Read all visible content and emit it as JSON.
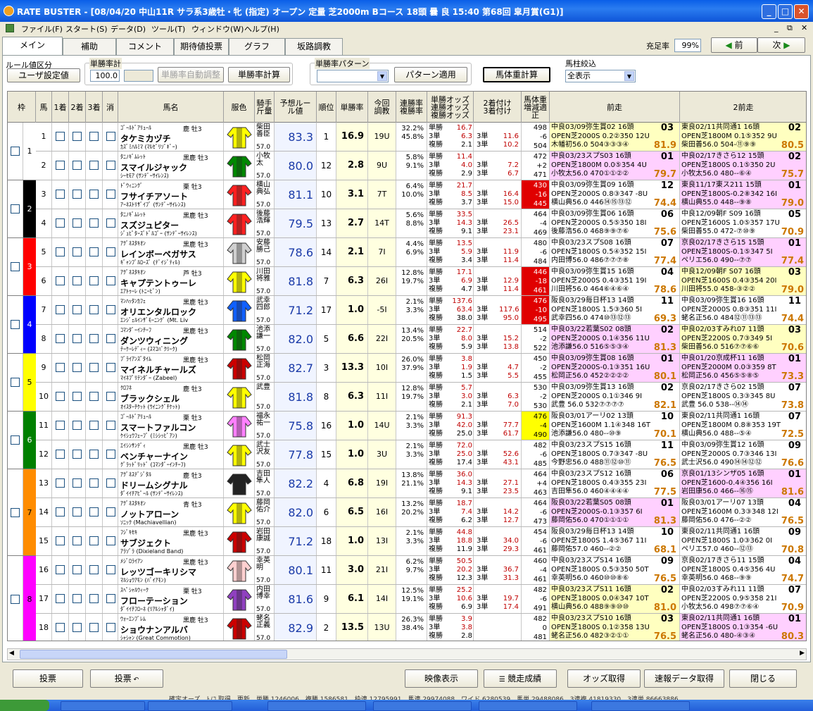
{
  "window": {
    "title": "RATE BUSTER - [08/04/20 中山11R サラ系3歳牡・牝 (指定) オープン 定量 芝2000m Bコース 18頭 曇 良 15:40 第68回 皐月賞(G1)]"
  },
  "menu": [
    "ファイル(F)",
    "スタート(S)",
    "データ(D)",
    "ツール(T)",
    "ウィンドウ(W)",
    "ヘルプ(H)"
  ],
  "tabs": [
    "メイン",
    "補助",
    "コメント",
    "期待値投票",
    "グラフ",
    "坂路調教"
  ],
  "top": {
    "fill_label": "充足率",
    "fill_value": "99%",
    "prev": "前",
    "next": "次"
  },
  "controls": {
    "rule_label": "ルール値区分",
    "rule_value": "ユーザ設定値",
    "winrate_total_label": "単勝率計",
    "winrate_total": "100.0",
    "auto_adjust": "単勝率自動調整",
    "winrate_calc": "単勝率計算",
    "pattern_label": "単勝率パターン",
    "pattern_apply": "パターン適用",
    "weight_calc": "馬体重計算",
    "filter_label": "馬柱絞込",
    "filter_value": "全表示"
  },
  "columns": {
    "waku": "枠",
    "uma": "馬",
    "c1": "1着",
    "c2": "2着",
    "c3": "3着",
    "kesu": "消",
    "name": "馬名",
    "silk": "服色",
    "jockey": "騎手斤量",
    "rate": "予想ルール値",
    "rank": "順位",
    "winrate": "単勝率",
    "chokyo": "今回調教",
    "rentai": "連勝率複勝率",
    "odds": "単勝オッズ連勝オッズ複勝オッズ",
    "tsuke": "2着付け3着付け",
    "bw": "馬体重増減適正",
    "prev1": "前走",
    "prev2": "2前走"
  },
  "waku": [
    {
      "n": "1",
      "color": "#ffffff",
      "rows": 2
    },
    {
      "n": "2",
      "color": "#000000",
      "rows": 2
    },
    {
      "n": "3",
      "color": "#ff0000",
      "rows": 2
    },
    {
      "n": "4",
      "color": "#0000ff",
      "rows": 2
    },
    {
      "n": "5",
      "color": "#ffff00",
      "rows": 2
    },
    {
      "n": "6",
      "color": "#008000",
      "rows": 2
    },
    {
      "n": "7",
      "color": "#ff8c00",
      "rows": 3
    },
    {
      "n": "8",
      "color": "#ff00ff",
      "rows": 3
    }
  ],
  "horses": [
    {
      "uma": "1",
      "sire": "ｺﾞｰﾙﾄﾞｱﾘｭｰﾙ",
      "sexage": "鹿 牡3",
      "name": "タケミカヅチ",
      "dam": "ｶｽﾞﾐﾊﾙﾐﾏ (ﾏﾙｾﾞﾘｿﾞｷﾞｰ)",
      "jockey": "柴田善臣",
      "weight": "57.0",
      "rate": "83.3",
      "rank": "1",
      "win": "16.9",
      "chk": "19U",
      "p1": "32.2%",
      "p2": "45.8%",
      "o1": "16.7",
      "o2": "6.3",
      "o3": "2.1",
      "t1": "11.6",
      "t2": "10.2",
      "b1": "498",
      "b2": "-6",
      "b3": "504",
      "bwbg": "",
      "pv1": [
        "中良03/09弥生賞02 16頭",
        "OPEN芝2000S 0.2②350 12U",
        "木幡初56.0 504③③③④"
      ],
      "pv1sc": "81.9",
      "pv1fin": "03",
      "pv1bg": "#ffffc0",
      "pv2": [
        "東良02/11共同通1 16頭",
        "OPEN芝1800M 0.1⑤352 9U",
        "柴田善56.0 504-⑪⑨⑨"
      ],
      "pv2sc": "80.5",
      "pv2fin": "02",
      "pv2bg": "#ffffc0"
    },
    {
      "uma": "2",
      "sire": "ﾀﾆﾉｷﾞﾑﾚｯﾄ",
      "sexage": "黒鹿 牡3",
      "name": "スマイルジャック",
      "dam": "ｼｰｾﾓｱ (ｻﾝﾃﾞｰｻｲﾚﾝｽ)",
      "jockey": "小牧太",
      "weight": "57.0",
      "rate": "80.0",
      "rank": "12",
      "win": "2.8",
      "chk": "9U",
      "p1": "5.8%",
      "p2": "9.1%",
      "o1": "11.4",
      "o2": "4.0",
      "o3": "2.9",
      "t1": "7.2",
      "t2": "6.7",
      "b1": "472",
      "b2": "+2",
      "b3": "471",
      "bwbg": "",
      "pv1": [
        "中良03/23スプS03 16頭",
        "OPEN芝1800M 0.0⑤354 4U",
        "小牧太56.0 470①①②②"
      ],
      "pv1sc": "79.7",
      "pv1fin": "01",
      "pv1bg": "#ffd0ff",
      "pv2": [
        "中良02/17きさら12 15頭",
        "OPEN芝1800S 0.1⑤350 2U",
        "小牧太56.0 480--⑥④"
      ],
      "pv2sc": "75.7",
      "pv2fin": "02",
      "pv2bg": "#ffd0ff"
    },
    {
      "uma": "3",
      "sire": "ﾄﾞｳｨﾆﾝｸﾞ",
      "sexage": "栗 牡3",
      "name": "フサイチアソート",
      "dam": "ｱｰﾈｽﾄﾘｻﾞｲﾌﾞ (ｻﾝﾃﾞｰｻｲﾚﾝｽ)",
      "jockey": "横山典弘",
      "weight": "57.0",
      "rate": "81.1",
      "rank": "10",
      "win": "3.1",
      "chk": "7T",
      "p1": "6.4%",
      "p2": "10.0%",
      "o1": "21.7",
      "o2": "8.5",
      "o3": "3.7",
      "t1": "16.4",
      "t2": "15.0",
      "b1": "430",
      "b2": "-16",
      "b3": "445",
      "bwbg": "#e00000",
      "pv1": [
        "中良03/09弥生賞09 16頭",
        "OPEN芝2000S 0.8③347 -8U",
        "横山典56.0 446⑭⑮⑬⑫"
      ],
      "pv1sc": "74.4",
      "pv1fin": "12",
      "pv1bg": "#ffffff",
      "pv2": [
        "東良11/17東ス211 15頭",
        "OPEN芝1800S-0.2⑧342 16I",
        "横山典55.0 448--⑨⑧"
      ],
      "pv2sc": "79.0",
      "pv2fin": "01",
      "pv2bg": "#ffd0ff"
    },
    {
      "uma": "4",
      "sire": "ﾀﾆﾉｷﾞﾑﾚｯﾄ",
      "sexage": "黒鹿 牡3",
      "name": "スズジュピター",
      "dam": "ｼﾞｭﾋﾟﾀｰｽﾞﾄﾞﾙｺﾞｰ (ｻﾝﾃﾞｰｻｲﾚﾝｽ)",
      "jockey": "後藤浩輝",
      "weight": "57.0",
      "rate": "79.5",
      "rank": "13",
      "win": "2.7",
      "chk": "14T",
      "p1": "5.6%",
      "p2": "8.8%",
      "o1": "33.5",
      "o2": "14.3",
      "o3": "9.1",
      "t1": "26.5",
      "t2": "23.1",
      "b1": "464",
      "b2": "-4",
      "b3": "469",
      "bwbg": "",
      "pv1": [
        "中良03/09弥生賞06 16頭",
        "OPEN芝2000S 0.5⑤350 18I",
        "後藤浩56.0 468⑨⑨⑦⑥"
      ],
      "pv1sc": "75.6",
      "pv1fin": "06",
      "pv1bg": "#ffffff",
      "pv2": [
        "中良12/09朝F S09 16頭",
        "OPEN芝1600S 1.0⑤357 17U",
        "柴田善55.0 472-⑦⑩⑨"
      ],
      "pv2sc": "70.9",
      "pv2fin": "05",
      "pv2bg": "#ffffff"
    },
    {
      "uma": "5",
      "sire": "ｱｸﾞﾈｽﾀｷｵﾝ",
      "sexage": "黒鹿 牡3",
      "name": "レインボーペガサス",
      "dam": "ｷﾞｬﾝﾌﾞﾙﾛｰｽﾞ (ﾃﾞｲｼﾞﾃｨﾙ)",
      "jockey": "安藤勝己",
      "weight": "57.0",
      "rate": "78.6",
      "rank": "14",
      "win": "2.1",
      "chk": "7I",
      "p1": "4.4%",
      "p2": "6.9%",
      "o1": "13.5",
      "o2": "5.9",
      "o3": "3.4",
      "t1": "11.9",
      "t2": "11.4",
      "b1": "480",
      "b2": "-6",
      "b3": "484",
      "bwbg": "",
      "pv1": [
        "中良03/23スプS08 16頭",
        "OPEN芝1800S 0.5④352 15I",
        "内田博56.0 486⑦⑦⑦⑧"
      ],
      "pv1sc": "77.4",
      "pv1fin": "07",
      "pv1bg": "#ffffff",
      "pv2": [
        "京良02/17きさら15 15頭",
        "OPEN芝1800S-0.1⑤347 5I",
        "ペリエ56.0 490--⑦⑦"
      ],
      "pv2sc": "77.4",
      "pv2fin": "01",
      "pv2bg": "#ffd0ff"
    },
    {
      "uma": "6",
      "sire": "ｱｸﾞﾈｽﾀｷｵﾝ",
      "sexage": "芦 牡3",
      "name": "キャプテントゥーレ",
      "dam": "ｴｱﾄｩｰﾚ (ﾄﾆｰﾋﾞﾝ)",
      "jockey": "川田将雅",
      "weight": "57.0",
      "rate": "81.8",
      "rank": "7",
      "win": "6.3",
      "chk": "26I",
      "p1": "12.8%",
      "p2": "19.7%",
      "o1": "17.1",
      "o2": "6.9",
      "o3": "4.7",
      "t1": "12.9",
      "t2": "11.4",
      "b1": "446",
      "b2": "-18",
      "b3": "461",
      "bwbg": "#e00000",
      "pv1": [
        "中良03/09弥生賞15 16頭",
        "OPEN芝2000S 0.4③351 19I",
        "川田将56.0 464⑥④⑥④"
      ],
      "pv1sc": "78.6",
      "pv1fin": "04",
      "pv1bg": "#ffffff",
      "pv2": [
        "中良12/09朝F S07 16頭",
        "OPEN芝1600S 0.4③354 20I",
        "川田将55.0 458-③②②"
      ],
      "pv2sc": "79.0",
      "pv2fin": "03",
      "pv2bg": "#ffffc0"
    },
    {
      "uma": "7",
      "sire": "ﾏﾝﾊｯﾀﾝｶﾌｪ",
      "sexage": "黒鹿 牡3",
      "name": "オリエンタルロック",
      "dam": "ｴﾝｼﾞｪﾙｲﾝｻﾞﾓｰﾆﾝｸﾞ (Mt. Liv",
      "jockey": "武幸四郎",
      "weight": "57.0",
      "rate": "71.2",
      "rank": "17",
      "win": "1.0",
      "chk": "-5I",
      "p1": "2.1%",
      "p2": "3.3%",
      "o1": "137.6",
      "o2": "63.4",
      "o3": "38.0",
      "t1": "117.6",
      "t2": "95.0",
      "b1": "476",
      "b2": "-10",
      "b3": "495",
      "bwbg": "#e00000",
      "pv1": [
        "阪良03/29毎日杯13 14頭",
        "OPEN芝1800S 1.5③360 5I",
        "武幸四56.0 474⑩⑬⑫⑬"
      ],
      "pv1sc": "69.3",
      "pv1fin": "11",
      "pv1bg": "#ffffff",
      "pv2": [
        "中良03/09弥生賞16 16頭",
        "OPEN芝2000S 0.8③351 11I",
        "蛯名正56.0 484⑫⑪⑬⑬"
      ],
      "pv2sc": "74.4",
      "pv2fin": "11",
      "pv2bg": "#ffffff"
    },
    {
      "uma": "8",
      "sire": "ｺﾏﾝﾀﾞｰｲﾝﾁｰﾌ",
      "sexage": "黒鹿 牡3",
      "name": "ダンツウィニング",
      "dam": "ﾃｰｹｰﾚﾃﾞｨｰ (ｽﾏｺﾊﾞｸﾘｰｸ)",
      "jockey": "池添謙一",
      "weight": "57.0",
      "rate": "82.0",
      "rank": "5",
      "win": "6.6",
      "chk": "22I",
      "p1": "13.4%",
      "p2": "20.5%",
      "o1": "22.7",
      "o2": "8.0",
      "o3": "5.9",
      "t1": "15.2",
      "t2": "13.8",
      "b1": "514",
      "b2": "-2",
      "b3": "522",
      "bwbg": "",
      "pv1": [
        "中良03/22若葉S02 08頭",
        "OPEN芝2000S 0.1④356 11U",
        "池添謙56.0 516⑤⑤③④"
      ],
      "pv1sc": "81.3",
      "pv1fin": "02",
      "pv1bg": "#ffd0ff",
      "pv2": [
        "中良02/03すみれ07 11頭",
        "OPEN芝2200S 0.7③349 5I",
        "柴田善56.0 516⑦⑦⑥⑥"
      ],
      "pv2sc": "70.6",
      "pv2fin": "03",
      "pv2bg": "#ffffc0"
    },
    {
      "uma": "9",
      "sire": "ﾌﾞﾗｲｱﾝｽﾞﾀｲﾑ",
      "sexage": "黒鹿 牡3",
      "name": "マイネルチャールズ",
      "dam": "ﾏｲﾈﾌﾟﾘﾃﾝﾀﾞｰ (Zabeel)",
      "jockey": "松岡正海",
      "weight": "57.0",
      "rate": "82.7",
      "rank": "3",
      "win": "13.3",
      "chk": "10I",
      "p1": "26.0%",
      "p2": "37.9%",
      "o1": "3.8",
      "o2": "1.9",
      "o3": "1.5",
      "t1": "4.7",
      "t2": "5.5",
      "b1": "450",
      "b2": "-2",
      "b3": "455",
      "bwbg": "",
      "pv1": [
        "中良03/09弥生賞08 16頭",
        "OPEN芝2000S-0.1③351 16U",
        "松岡正56.0 452②②②②"
      ],
      "pv1sc": "80.1",
      "pv1fin": "01",
      "pv1bg": "#ffd0ff",
      "pv2": [
        "中良01/20京成杯11 16頭",
        "OPEN芝2000M 0.0③359 8T",
        "松岡正56.0 456⑤⑤⑧⑤"
      ],
      "pv2sc": "73.3",
      "pv2fin": "01",
      "pv2bg": "#ffd0ff"
    },
    {
      "uma": "10",
      "sire": "ｸﾛﾌﾈ",
      "sexage": "鹿 牡3",
      "name": "ブラックシェル",
      "dam": "ｵｲｽﾀｰﾁｹｯﾄ (ｳｲﾆﾝｸﾞﾁｹｯﾄ)",
      "jockey": "武豊",
      "weight": "57.0",
      "rate": "81.8",
      "rank": "8",
      "win": "6.3",
      "chk": "11I",
      "p1": "12.8%",
      "p2": "19.7%",
      "o1": "5.7",
      "o2": "3.0",
      "o3": "2.1",
      "t1": "6.3",
      "t2": "7.0",
      "b1": "530",
      "b2": "-2",
      "b3": "530",
      "bwbg": "",
      "pv1": [
        "中良03/09弥生賞13 16頭",
        "OPEN芝2000S 0.1①346 9I",
        "武豊  56.0 532⑦⑦⑦⑦"
      ],
      "pv1sc": "82.1",
      "pv1fin": "02",
      "pv1bg": "#ffffff",
      "pv2": [
        "京良02/17きさら02 15頭",
        "OPEN芝1800S 0.3③345 8U",
        "武豊  56.0 538--⑭⑭"
      ],
      "pv2sc": "73.8",
      "pv2fin": "07",
      "pv2bg": "#ffffff"
    },
    {
      "uma": "11",
      "sire": "ｺﾞｰﾙﾄﾞｱﾘｭｰﾙ",
      "sexage": "栗 牡3",
      "name": "スマートファルコン",
      "dam": "ｹｲｼｭｳﾌｪｰﾌﾞ (ﾐｼｼｯﾋﾟｱﾝ)",
      "jockey": "福永祐一",
      "weight": "57.0",
      "rate": "75.8",
      "rank": "16",
      "win": "1.0",
      "chk": "14U",
      "p1": "2.1%",
      "p2": "3.3%",
      "o1": "91.3",
      "o2": "42.0",
      "o3": "25.0",
      "t1": "77.7",
      "t2": "61.7",
      "b1": "476",
      "b2": "-4",
      "b3": "490",
      "bwbg": "#ffff00",
      "pv1": [
        "阪良03/01アーリ02 13頭",
        "OPEN芝1600M 1.1④348 16T",
        "池添謙56.0 480--⑩⑨"
      ],
      "pv1sc": "70.1",
      "pv1fin": "10",
      "pv1bg": "#ffffff",
      "pv2": [
        "東良02/11共同通1 16頭",
        "OPEN芝1800M 0.8⑧353 19T",
        "横山典56.0 488--⑤④"
      ],
      "pv2sc": "72.5",
      "pv2fin": "07",
      "pv2bg": "#ffffff"
    },
    {
      "uma": "12",
      "sire": "ｴｲｼﾝｻﾝﾃﾞｨ",
      "sexage": "黒鹿 牡3",
      "name": "ベンチャーナイン",
      "dam": "ｸﾞﾗｯﾄﾞﾘｯﾄﾞ (ｺﾏﾝﾀﾞｰｲﾝﾁｰﾌ)",
      "jockey": "武士沢友",
      "weight": "57.0",
      "rate": "77.8",
      "rank": "15",
      "win": "1.0",
      "chk": "3U",
      "p1": "2.1%",
      "p2": "3.3%",
      "o1": "72.0",
      "o2": "25.0",
      "o3": "17.4",
      "t1": "52.6",
      "t2": "43.1",
      "b1": "482",
      "b2": "-6",
      "b3": "485",
      "bwbg": "",
      "pv1": [
        "中良03/23スプS15 16頭",
        "OPEN芝1800S 0.7③347 -8U",
        "今野忠56.0 488⑪⑫⑩⑪"
      ],
      "pv1sc": "76.5",
      "pv1fin": "11",
      "pv1bg": "#ffffff",
      "pv2": [
        "中良03/09弥生賞12 16頭",
        "OPEN芝2000S 0.7③346 13I",
        "武士沢56.0 490⑭⑭⑫⑫"
      ],
      "pv2sc": "76.6",
      "pv2fin": "09",
      "pv2bg": "#ffffff"
    },
    {
      "uma": "13",
      "sire": "ｱｸﾞﾈｽﾃﾞｼﾞﾀﾙ",
      "sexage": "鹿 牡3",
      "name": "ドリームシグナル",
      "dam": "ﾀﾞｲｲﾁｱﾋﾟｰﾙ (ｻﾝﾃﾞｰｻｲﾚﾝｽ)",
      "jockey": "吉田隼人",
      "weight": "57.0",
      "rate": "82.2",
      "rank": "4",
      "win": "6.8",
      "chk": "19I",
      "p1": "13.8%",
      "p2": "21.1%",
      "o1": "36.0",
      "o2": "14.3",
      "o3": "9.1",
      "t1": "27.1",
      "t2": "23.5",
      "b1": "464",
      "b2": "+4",
      "b3": "463",
      "bwbg": "",
      "pv1": [
        "中良03/23スプS12 16頭",
        "OPEN芝1800S 0.4③355 23I",
        "吉田隼56.0 460④④④④"
      ],
      "pv1sc": "77.5",
      "pv1fin": "06",
      "pv1bg": "#ffffff",
      "pv2": [
        "京良01/13シンザ05 16頭",
        "OPEN芝1600-0.4④356 16I",
        "岩田康56.0 466--⑯⑮"
      ],
      "pv2sc": "81.6",
      "pv2fin": "01",
      "pv2bg": "#ffd0ff"
    },
    {
      "uma": "14",
      "sire": "ｱｸﾞﾈｽﾀｷｵﾝ",
      "sexage": "青 牡3",
      "name": "ノットアローン",
      "dam": "ｿﾆｯｸ (Machiavellian)",
      "jockey": "藤岡佑介",
      "weight": "57.0",
      "rate": "82.0",
      "rank": "6",
      "win": "6.5",
      "chk": "16I",
      "p1": "13.2%",
      "p2": "20.2%",
      "o1": "18.7",
      "o2": "7.4",
      "o3": "6.2",
      "t1": "14.2",
      "t2": "12.7",
      "b1": "464",
      "b2": "-6",
      "b3": "473",
      "bwbg": "",
      "pv1": [
        "阪良03/22若葉S05 08頭",
        "OPEN芝2000S-0.1③357 6I",
        "藤岡佑56.0 470①①①①"
      ],
      "pv1sc": "81.3",
      "pv1fin": "01",
      "pv1bg": "#ffd0ff",
      "pv2": [
        "阪良03/01アーリ07 13頭",
        "OPEN芝1600M 0.3③348 12I",
        "藤岡佑56.0 476--②②"
      ],
      "pv2sc": "76.5",
      "pv2fin": "04",
      "pv2bg": "#ffffff"
    },
    {
      "uma": "15",
      "sire": "ﾌｼﾞｷｾｷ",
      "sexage": "黒鹿 牡3",
      "name": "サブジェクト",
      "dam": "ｱﾗｿﾞﾗ (Dixieland Band)",
      "jockey": "岩田康誠",
      "weight": "57.0",
      "rate": "71.2",
      "rank": "18",
      "win": "1.0",
      "chk": "13I",
      "p1": "2.1%",
      "p2": "3.3%",
      "o1": "44.8",
      "o2": "18.8",
      "o3": "11.9",
      "t1": "34.0",
      "t2": "29.3",
      "b1": "454",
      "b2": "-6",
      "b3": "461",
      "bwbg": "",
      "pv1": [
        "阪良03/29毎日杯13 14頭",
        "OPEN芝1800S 1.4⑤367 11I",
        "藤岡佑57.0 460--②②"
      ],
      "pv1sc": "68.1",
      "pv1fin": "10",
      "pv1bg": "#ffffff",
      "pv2": [
        "東良02/11共同通1 16頭",
        "OPEN芝1800S 1.0③362 0I",
        "ペリエ57.0 460--⑫⑬"
      ],
      "pv2sc": "70.8",
      "pv2fin": "09",
      "pv2bg": "#ffffff"
    },
    {
      "uma": "16",
      "sire": "ﾒｼﾞﾛﾗｲｱﾝ",
      "sexage": "黒鹿 牡3",
      "name": "レッツゴーキリシマ",
      "dam": "ﾏﾙｼｮｳｱﾓﾝ (ﾊﾞｲｱﾓﾝ)",
      "jockey": "幸英明",
      "weight": "57.0",
      "rate": "80.1",
      "rank": "11",
      "win": "3.0",
      "chk": "21I",
      "p1": "6.2%",
      "p2": "9.7%",
      "o1": "50.5",
      "o2": "20.2",
      "o3": "12.3",
      "t1": "36.7",
      "t2": "31.3",
      "b1": "460",
      "b2": "-4",
      "b3": "461",
      "bwbg": "",
      "pv1": [
        "中良03/23スプS14 16頭",
        "OPEN芝1800S 0.5③350 50T",
        "幸英明56.0 460⑩⑩⑧⑥"
      ],
      "pv1sc": "76.5",
      "pv1fin": "09",
      "pv1bg": "#ffffff",
      "pv2": [
        "京良02/17きさら11 15頭",
        "OPEN芝1800S 0.4⑤356 4U",
        "幸英明56.0 468--⑨⑨"
      ],
      "pv2sc": "74.7",
      "pv2fin": "04",
      "pv2bg": "#ffffff"
    },
    {
      "uma": "17",
      "sire": "ｽﾍﾟｼｬﾙｳｨｰｸ",
      "sexage": "栗 牡3",
      "name": "フローテーション",
      "dam": "ﾀﾞｲｲﾁﾌﾛｰﾈ (ﾘｱﾙｼｬﾀﾞｲ)",
      "jockey": "内田博幸",
      "weight": "57.0",
      "rate": "81.6",
      "rank": "9",
      "win": "6.1",
      "chk": "14I",
      "p1": "12.5%",
      "p2": "19.1%",
      "o1": "25.2",
      "o2": "10.6",
      "o3": "6.9",
      "t1": "19.7",
      "t2": "17.4",
      "b1": "482",
      "b2": "-6",
      "b3": "491",
      "bwbg": "",
      "pv1": [
        "中良03/23スプS11 16頭",
        "OPEN芝1800S 0.0④347 10T",
        "横山典56.0 488⑨⑨⑩⑩"
      ],
      "pv1sc": "81.0",
      "pv1fin": "02",
      "pv1bg": "#ffffc0",
      "pv2": [
        "中良02/03すみれ11 11頭",
        "OPEN芝2200S 0.9⑤358 21I",
        "小牧太56.0 498⑦⑦⑥④"
      ],
      "pv2sc": "70.9",
      "pv2fin": "07",
      "pv2bg": "#ffffff"
    },
    {
      "uma": "18",
      "sire": "ｳｫｰｴﾝﾌﾞﾚﾑ",
      "sexage": "黒鹿 牡3",
      "name": "ショウナンアルバ",
      "dam": "ｼｬｼｬﾝ (Great Commotion)",
      "jockey": "蛯名正義",
      "weight": "57.0",
      "rate": "82.9",
      "rank": "2",
      "win": "13.5",
      "chk": "13U",
      "p1": "26.3%",
      "p2": "38.4%",
      "o1": "3.9",
      "o2": "3.8",
      "o3": "2.8",
      "t1": "",
      "t2": "",
      "b1": "482",
      "b2": "0",
      "b3": "481",
      "bwbg": "",
      "pv1": [
        "中良03/23スプS10 16頭",
        "OPEN芝1800S 0.1②358 13U",
        "蛯名正56.0 482③②①①"
      ],
      "pv1sc": "76.5",
      "pv1fin": "03",
      "pv1bg": "#ffffc0",
      "pv2": [
        "東良02/11共同通1 16頭",
        "OPEN芝1800S 0.1③354 -6U",
        "蛯名正56.0 480-④③④"
      ],
      "pv2sc": "80.3",
      "pv2fin": "01",
      "pv2bg": "#ffd0ff"
    }
  ],
  "oddlabels": [
    "単勝",
    "3単",
    "複勝"
  ],
  "bottom": {
    "bet1": "投票",
    "bet2": "投票",
    "video": "映像表示",
    "result": "競走成績",
    "odds": "オッズ取得",
    "fast": "速報データ取得",
    "close": "閉じる"
  },
  "status": "確定オーズ　ﾄﾉｺ 取得　更新　単勝 1246006　複勝 1586581　枠連 12795991　馬連 29974088　ワイド 6280539　馬単 29488086　3連複 41819330　3連単 86663886"
}
